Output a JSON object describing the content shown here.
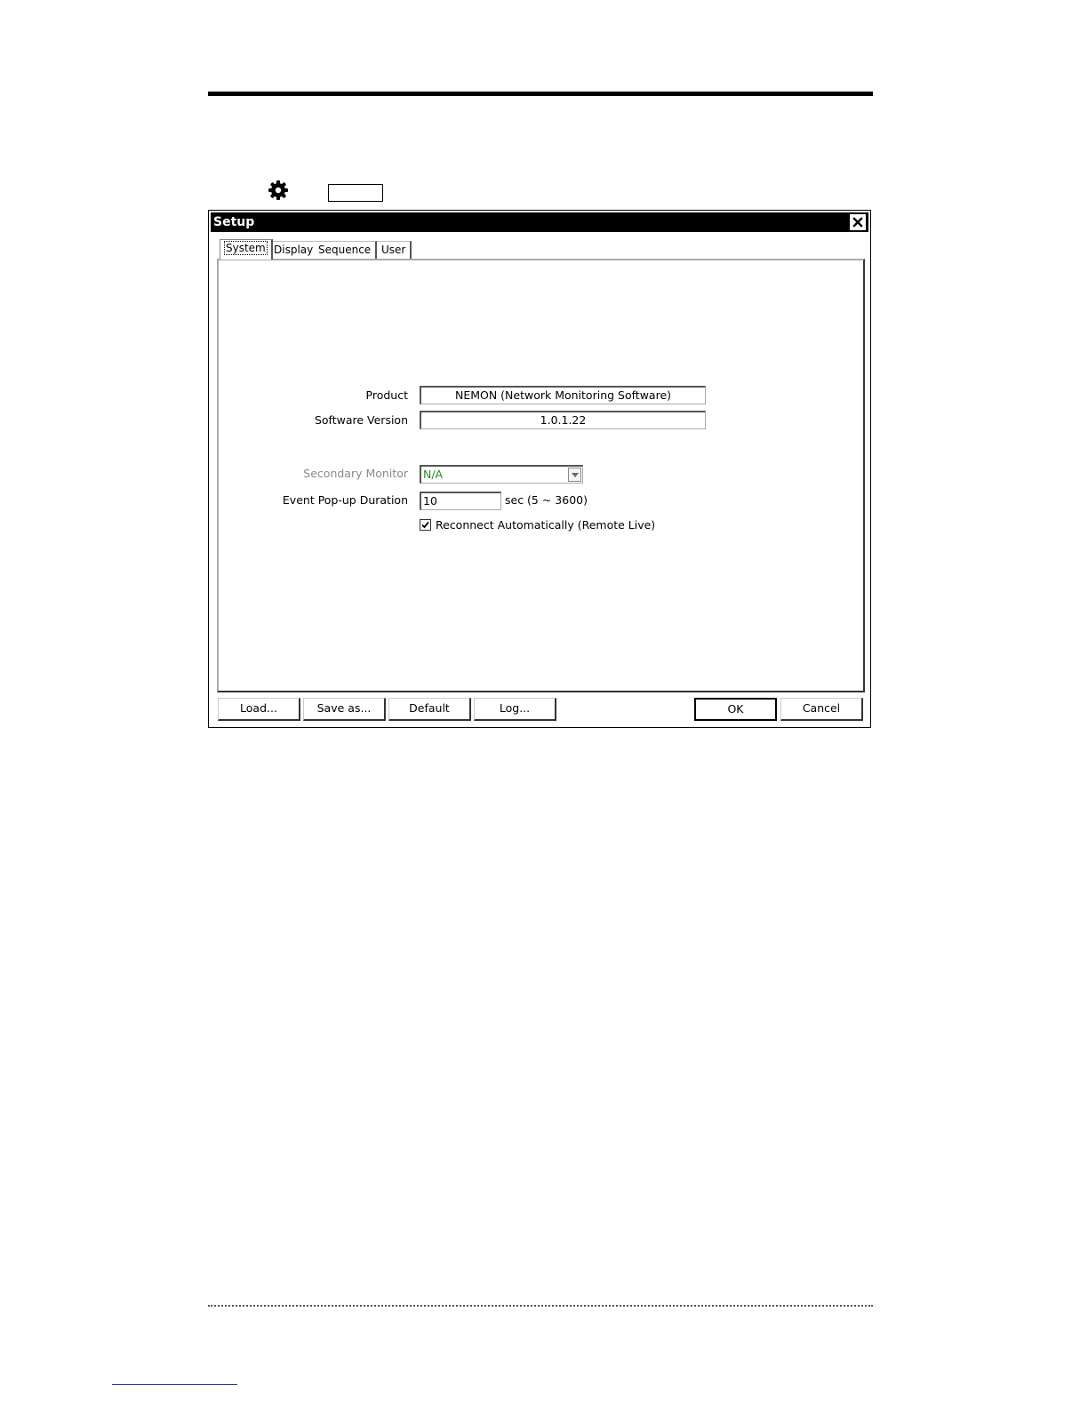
{
  "dialog": {
    "title": "Setup"
  },
  "tabs": [
    {
      "label": "System",
      "active": true
    },
    {
      "label": "Display",
      "active": false
    },
    {
      "label": "Sequence",
      "active": false
    },
    {
      "label": "User",
      "active": false
    }
  ],
  "system": {
    "product_label": "Product",
    "product_value": "NEMON (Network Monitoring Software)",
    "version_label": "Software Version",
    "version_value": "1.0.1.22",
    "secondary_monitor_label": "Secondary Monitor",
    "secondary_monitor_value": "N/A",
    "event_popup_label": "Event Pop-up Duration",
    "event_popup_value": "10",
    "event_popup_unit": "sec  (5 ~ 3600)",
    "reconnect_label": "Reconnect Automatically (Remote Live)",
    "reconnect_checked": true
  },
  "buttons": {
    "load": "Load...",
    "save_as": "Save as...",
    "default": "Default",
    "log": "Log...",
    "ok": "OK",
    "cancel": "Cancel"
  },
  "icons": {
    "gear": "gear-icon",
    "close": "close-icon",
    "dropdown": "chevron-down-icon",
    "check": "check-icon"
  },
  "colors": {
    "titlebar": "#000000",
    "disabled_label": "#8a8a8a",
    "select_value": "#2a8a2a"
  }
}
